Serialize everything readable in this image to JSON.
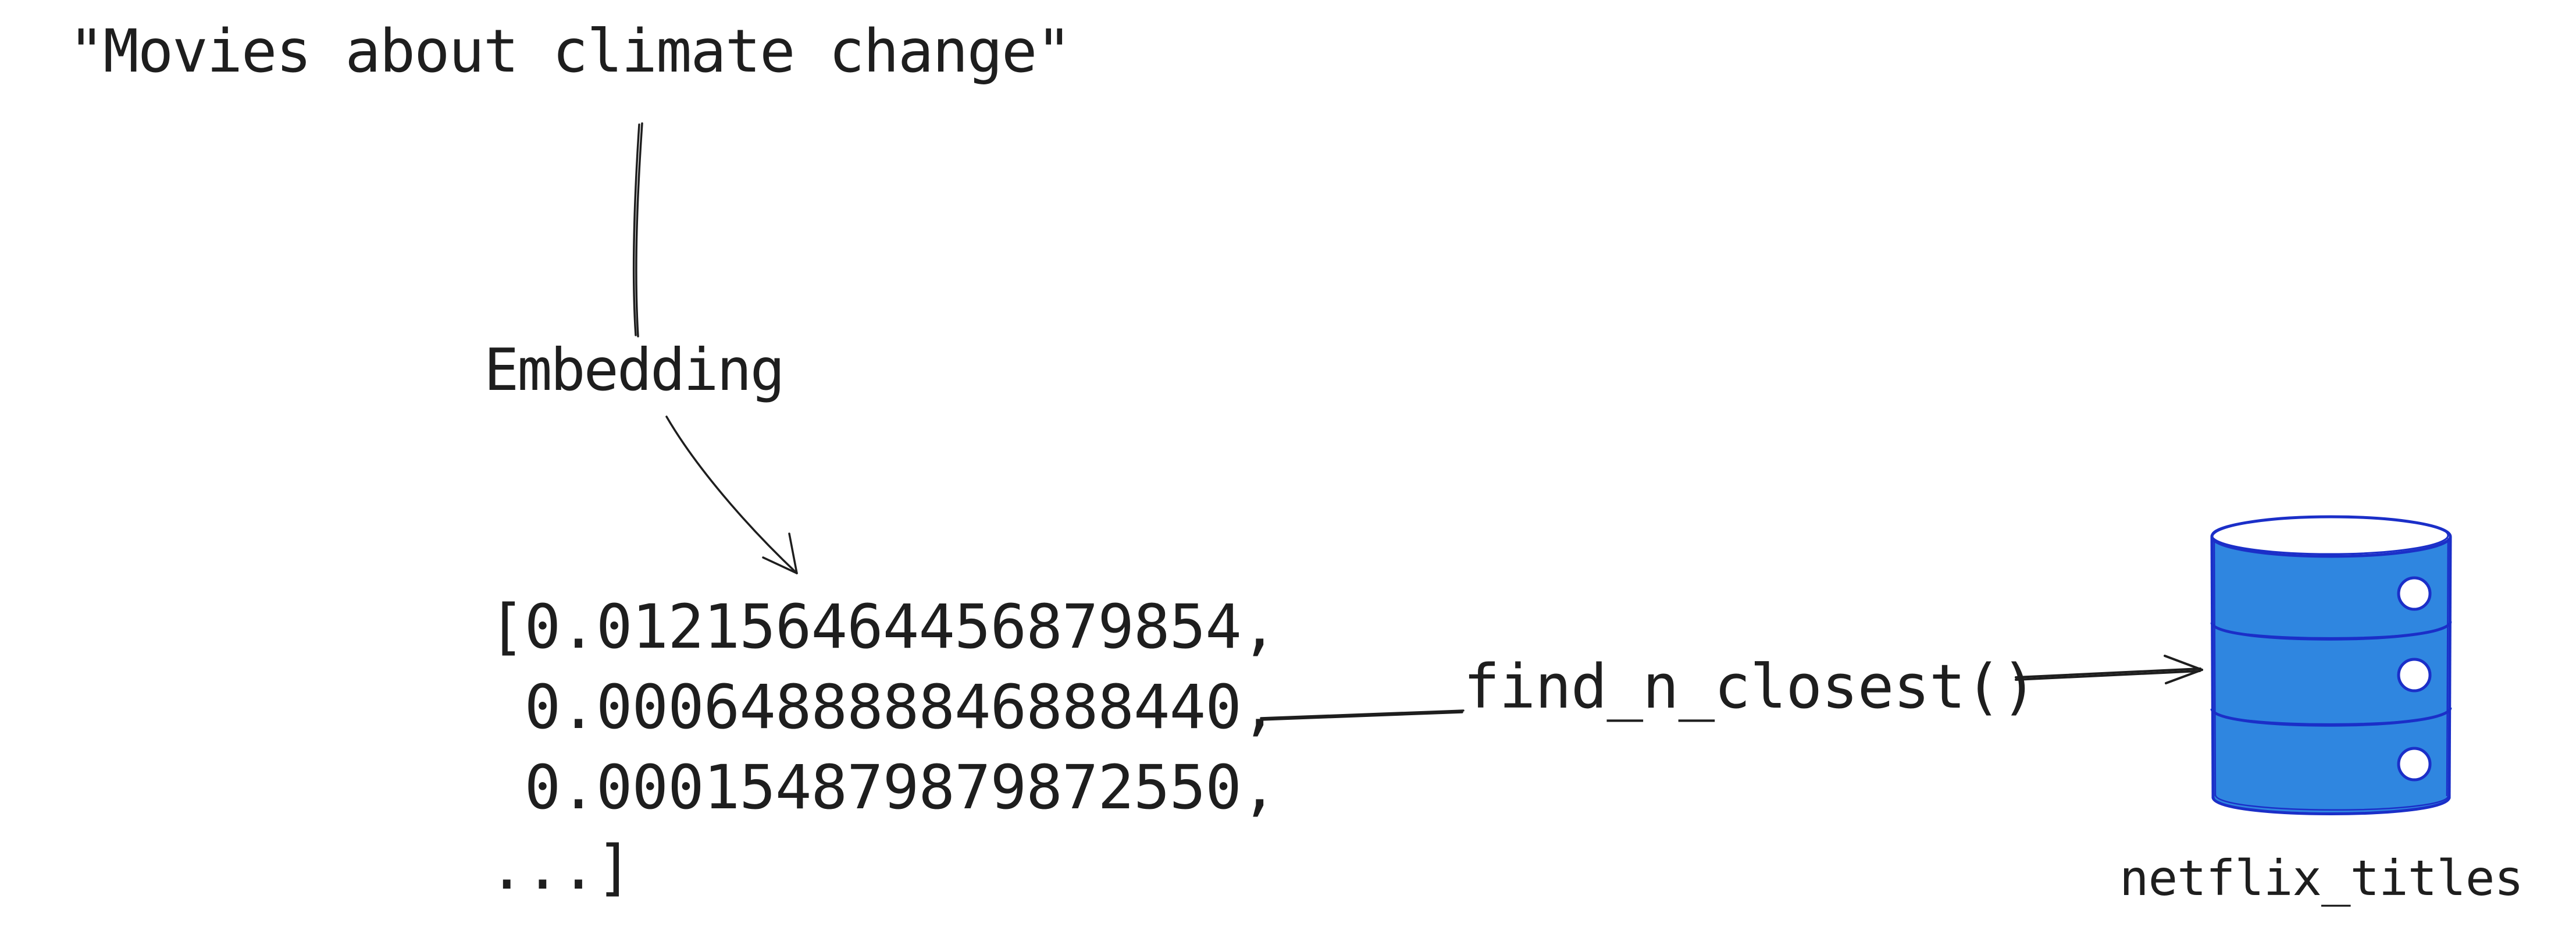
{
  "query": {
    "text": "\"Movies about climate change\""
  },
  "embedding": {
    "label": "Embedding"
  },
  "vector": {
    "lines": [
      "[0.012156464456879854,",
      " 0.000648888846888440,",
      " 0.000154879879872550,",
      "...]"
    ]
  },
  "search": {
    "function_label": "find_n_closest()"
  },
  "database": {
    "label": "netflix_titles",
    "icon": "database-icon",
    "fill_color": "#2f86e0",
    "stroke_color": "#1b2fc8"
  },
  "ink_color": "#1e1e1e"
}
